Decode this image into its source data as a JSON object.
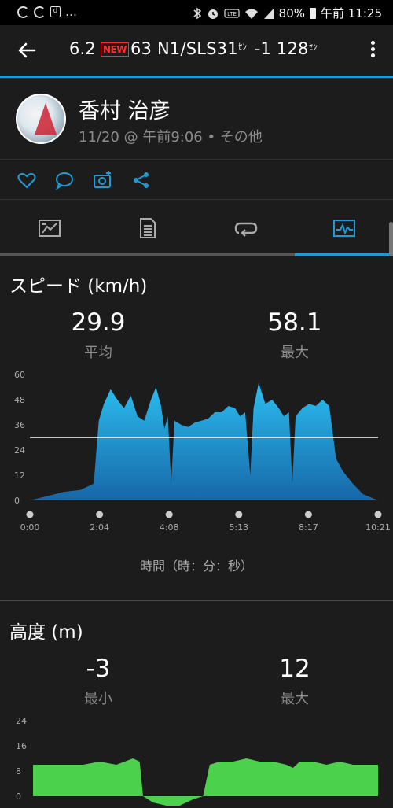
{
  "status_bar": {
    "battery": "80%",
    "time": "午前 11:25"
  },
  "app_bar": {
    "ticker_a": "6.2",
    "new_badge": "NEW",
    "ticker_b": "63 N1/SLS31",
    "ticker_unit1": "ｾﾝ",
    "ticker_c": " -1 128",
    "ticker_unit2": "ｾﾝ"
  },
  "profile": {
    "name": "香村 治彦",
    "activity_info": "11/20 @ 午前9:06 • その他"
  },
  "actions": [
    {
      "icon": "heart-icon"
    },
    {
      "icon": "comment-icon"
    },
    {
      "icon": "add-photo-icon"
    },
    {
      "icon": "share-icon"
    }
  ],
  "tabs": [
    {
      "icon": "summary-icon",
      "selected": false
    },
    {
      "icon": "details-icon",
      "selected": false
    },
    {
      "icon": "laps-icon",
      "selected": false
    },
    {
      "icon": "charts-icon",
      "selected": true
    }
  ],
  "accent_color": "#1e9bd7",
  "speed": {
    "title": "スピード (km/h)",
    "avg_value": "29.9",
    "avg_label": "平均",
    "max_value": "58.1",
    "max_label": "最大",
    "axis_title": "時間（時：分：秒）",
    "fill_color": "#1ea7df"
  },
  "altitude": {
    "title": "高度 (m)",
    "min_value": "-3",
    "min_label": "最小",
    "max_value": "12",
    "max_label": "最大",
    "fill_color": "#4cd14c"
  },
  "chart_data": [
    {
      "type": "area",
      "title": "スピード (km/h)",
      "xlabel": "時間（時：分：秒）",
      "ylabel": "",
      "x_ticks": [
        "0:00",
        "2:04",
        "4:08",
        "5:13",
        "8:17",
        "10:21"
      ],
      "y_ticks": [
        0,
        12,
        24,
        36,
        48,
        60
      ],
      "ylim": [
        0,
        60
      ],
      "average_line": 29.9,
      "x_minutes": [
        0,
        0.5,
        1.0,
        1.5,
        1.9,
        2.05,
        2.2,
        2.4,
        2.6,
        2.8,
        3.0,
        3.2,
        3.4,
        3.6,
        3.75,
        3.9,
        4.0,
        4.1,
        4.2,
        4.3,
        4.5,
        4.7,
        4.9,
        5.1,
        5.3,
        5.5,
        5.7,
        5.9,
        6.1,
        6.25,
        6.4,
        6.55,
        6.65,
        6.8,
        7.0,
        7.2,
        7.4,
        7.55,
        7.7,
        7.8,
        7.9,
        8.1,
        8.3,
        8.5,
        8.7,
        8.9,
        9.1,
        9.3,
        9.6,
        9.9,
        10.35
      ],
      "values": [
        0,
        2,
        4,
        5,
        8,
        38,
        46,
        53,
        48,
        44,
        50,
        40,
        38,
        48,
        54,
        45,
        34,
        40,
        8,
        38,
        36,
        35,
        37,
        38,
        39,
        42,
        42,
        45,
        44,
        40,
        42,
        12,
        44,
        56,
        46,
        48,
        44,
        40,
        42,
        8,
        40,
        44,
        46,
        45,
        48,
        45,
        20,
        14,
        8,
        3,
        0
      ]
    },
    {
      "type": "area",
      "title": "高度 (m)",
      "y_ticks": [
        0,
        8,
        16,
        24
      ],
      "ylim": [
        -3,
        24
      ],
      "x_minutes": [
        0,
        0.5,
        1.0,
        1.5,
        2.0,
        2.5,
        3.0,
        3.2,
        3.3,
        3.6,
        4.0,
        4.4,
        4.8,
        5.1,
        5.3,
        5.6,
        6.0,
        6.4,
        6.8,
        7.2,
        7.6,
        7.8,
        8.0,
        8.4,
        8.8,
        9.2,
        9.6,
        10.35
      ],
      "values": [
        10,
        10,
        10,
        10,
        11,
        10,
        12,
        11,
        0,
        -2,
        -3,
        -3,
        -1,
        0,
        10,
        11,
        11,
        12,
        11,
        11,
        10,
        9,
        11,
        11,
        10,
        11,
        10,
        10
      ]
    }
  ]
}
